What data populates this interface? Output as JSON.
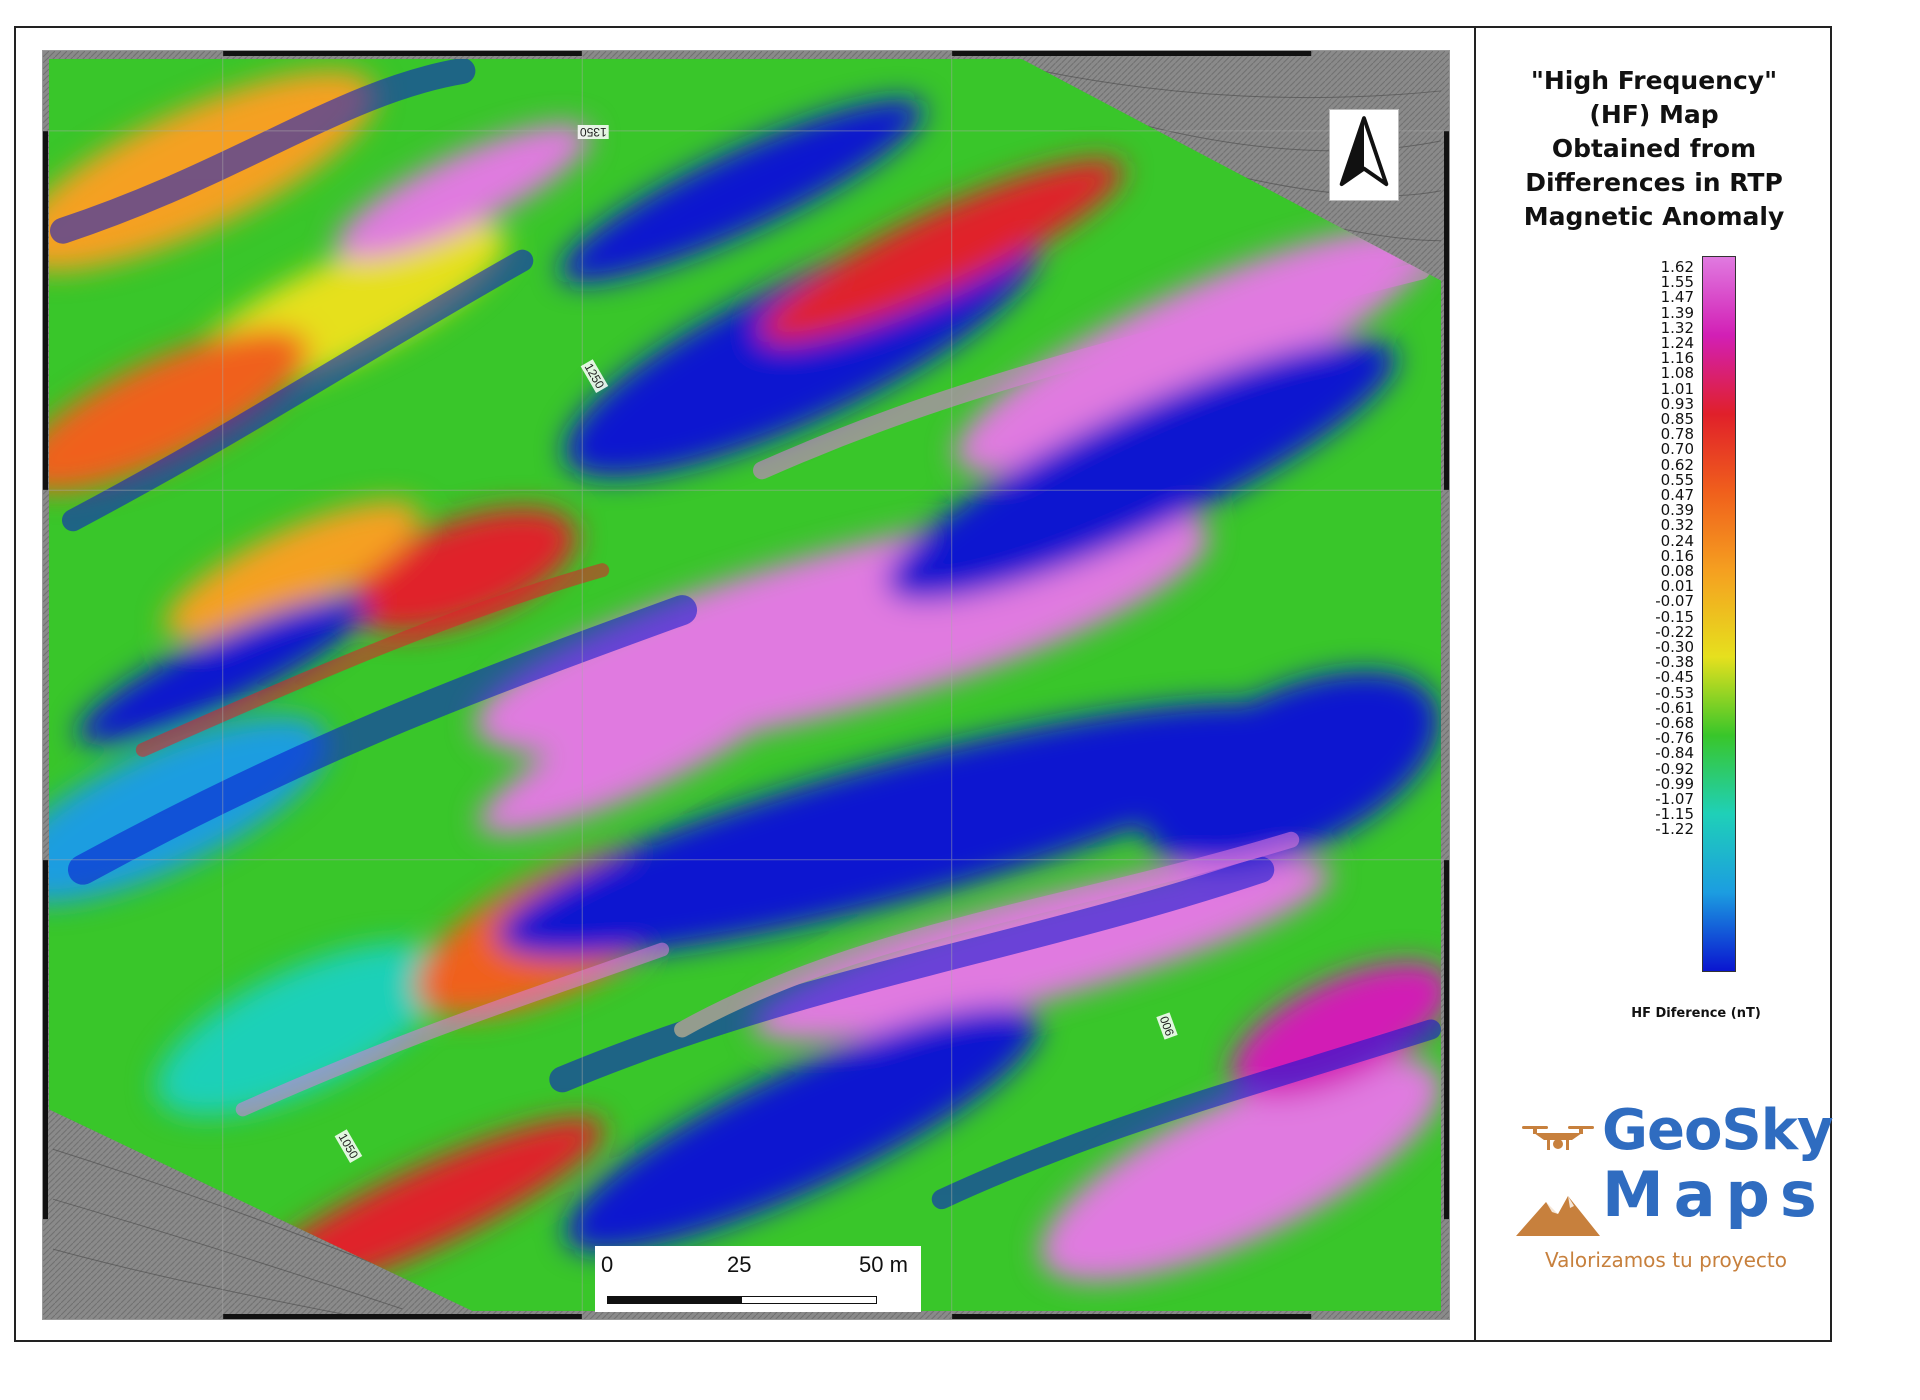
{
  "map": {
    "contour_labels": [
      "1350",
      "1250",
      "900",
      "1050"
    ],
    "north_arrow_icon": "north-arrow-icon",
    "scale_bar": {
      "labels": [
        "0",
        "25",
        "50 m"
      ],
      "max_value": 50,
      "unit": "m"
    }
  },
  "legend": {
    "title_lines": [
      "\"High Frequency\"",
      "(HF) Map",
      "Obtained from",
      "Differences in RTP",
      "Magnetic Anomaly"
    ],
    "ticks": [
      "1.62",
      "1.55",
      "1.47",
      "1.39",
      "1.32",
      "1.24",
      "1.16",
      "1.08",
      "1.01",
      "0.93",
      "0.85",
      "0.78",
      "0.70",
      "0.62",
      "0.55",
      "0.47",
      "0.39",
      "0.32",
      "0.24",
      "0.16",
      "0.08",
      "0.01",
      "-0.07",
      "-0.15",
      "-0.22",
      "-0.30",
      "-0.38",
      "-0.45",
      "-0.53",
      "-0.61",
      "-0.68",
      "-0.76",
      "-0.84",
      "-0.92",
      "-0.99",
      "-1.07",
      "-1.15",
      "-1.22"
    ],
    "unit_label": "HF Diference (nT)",
    "colors": [
      "#e07ae0",
      "#d21fb5",
      "#e0202a",
      "#f0601c",
      "#f5a020",
      "#e6e01e",
      "#39c62a",
      "#1fd0b8",
      "#1c9de0",
      "#0a15d0"
    ]
  },
  "logo": {
    "line1": "GeoSky",
    "line2": "Maps",
    "tagline": "Valorizamos tu proyecto",
    "icons": [
      "drone-icon",
      "mountain-icon"
    ],
    "brand_blue": "#2f6cc0",
    "brand_orange": "#c7803d"
  }
}
